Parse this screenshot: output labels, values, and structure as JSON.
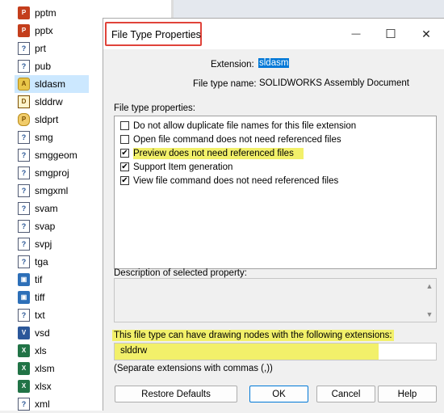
{
  "left_list": {
    "items": [
      {
        "label": "pptm",
        "icon": "powerpoint-icon",
        "badge": "P"
      },
      {
        "label": "pptx",
        "icon": "powerpoint-icon",
        "badge": "P"
      },
      {
        "label": "prt",
        "icon": "unknown-file-icon",
        "badge": "?"
      },
      {
        "label": "pub",
        "icon": "unknown-file-icon",
        "badge": "?"
      },
      {
        "label": "sldasm",
        "icon": "solidworks-assembly-icon",
        "badge": "A",
        "selected": true
      },
      {
        "label": "slddrw",
        "icon": "solidworks-drawing-icon",
        "badge": "D"
      },
      {
        "label": "sldprt",
        "icon": "solidworks-part-icon",
        "badge": "P"
      },
      {
        "label": "smg",
        "icon": "unknown-file-icon",
        "badge": "?"
      },
      {
        "label": "smggeom",
        "icon": "unknown-file-icon",
        "badge": "?"
      },
      {
        "label": "smgproj",
        "icon": "unknown-file-icon",
        "badge": "?"
      },
      {
        "label": "smgxml",
        "icon": "unknown-file-icon",
        "badge": "?"
      },
      {
        "label": "svam",
        "icon": "unknown-file-icon",
        "badge": "?"
      },
      {
        "label": "svap",
        "icon": "unknown-file-icon",
        "badge": "?"
      },
      {
        "label": "svpj",
        "icon": "unknown-file-icon",
        "badge": "?"
      },
      {
        "label": "tga",
        "icon": "unknown-file-icon",
        "badge": "?"
      },
      {
        "label": "tif",
        "icon": "image-file-icon",
        "badge": "▣"
      },
      {
        "label": "tiff",
        "icon": "image-file-icon",
        "badge": "▣"
      },
      {
        "label": "txt",
        "icon": "unknown-file-icon",
        "badge": "?"
      },
      {
        "label": "vsd",
        "icon": "visio-icon",
        "badge": "V"
      },
      {
        "label": "xls",
        "icon": "excel-icon",
        "badge": "X"
      },
      {
        "label": "xlsm",
        "icon": "excel-icon",
        "badge": "X"
      },
      {
        "label": "xlsx",
        "icon": "excel-icon",
        "badge": "X"
      },
      {
        "label": "xml",
        "icon": "unknown-file-icon",
        "badge": "?"
      }
    ]
  },
  "dialog": {
    "title": "File Type Properties",
    "minimize_glyph": "—",
    "maximize_glyph": "☐",
    "close_glyph": "✕",
    "extension_label": "Extension:",
    "extension_value": "sldasm",
    "file_type_name_label": "File type name:",
    "file_type_name_value": "SOLIDWORKS Assembly Document",
    "properties_label": "File type properties:",
    "properties": [
      {
        "label": "Do not allow duplicate file names for this file extension",
        "checked": false,
        "highlighted": false
      },
      {
        "label": "Open file command does not need referenced files",
        "checked": false,
        "highlighted": false
      },
      {
        "label": "Preview does not need referenced files",
        "checked": true,
        "highlighted": true
      },
      {
        "label": "Support Item generation",
        "checked": true,
        "highlighted": false
      },
      {
        "label": "View file command does not need referenced files",
        "checked": true,
        "highlighted": false
      }
    ],
    "description_label": "Description of selected property:",
    "drawing_nodes_label": "This file type can have drawing nodes with the following extensions:",
    "drawing_nodes_value": "slddrw",
    "separator_hint": "(Separate extensions with commas (,))",
    "buttons": {
      "restore": "Restore Defaults",
      "ok": "OK",
      "cancel": "Cancel",
      "help": "Help"
    }
  },
  "colors": {
    "highlight_yellow": "#f2f06a",
    "title_outline_red": "#e0433a",
    "selection_blue": "#0078d7"
  }
}
